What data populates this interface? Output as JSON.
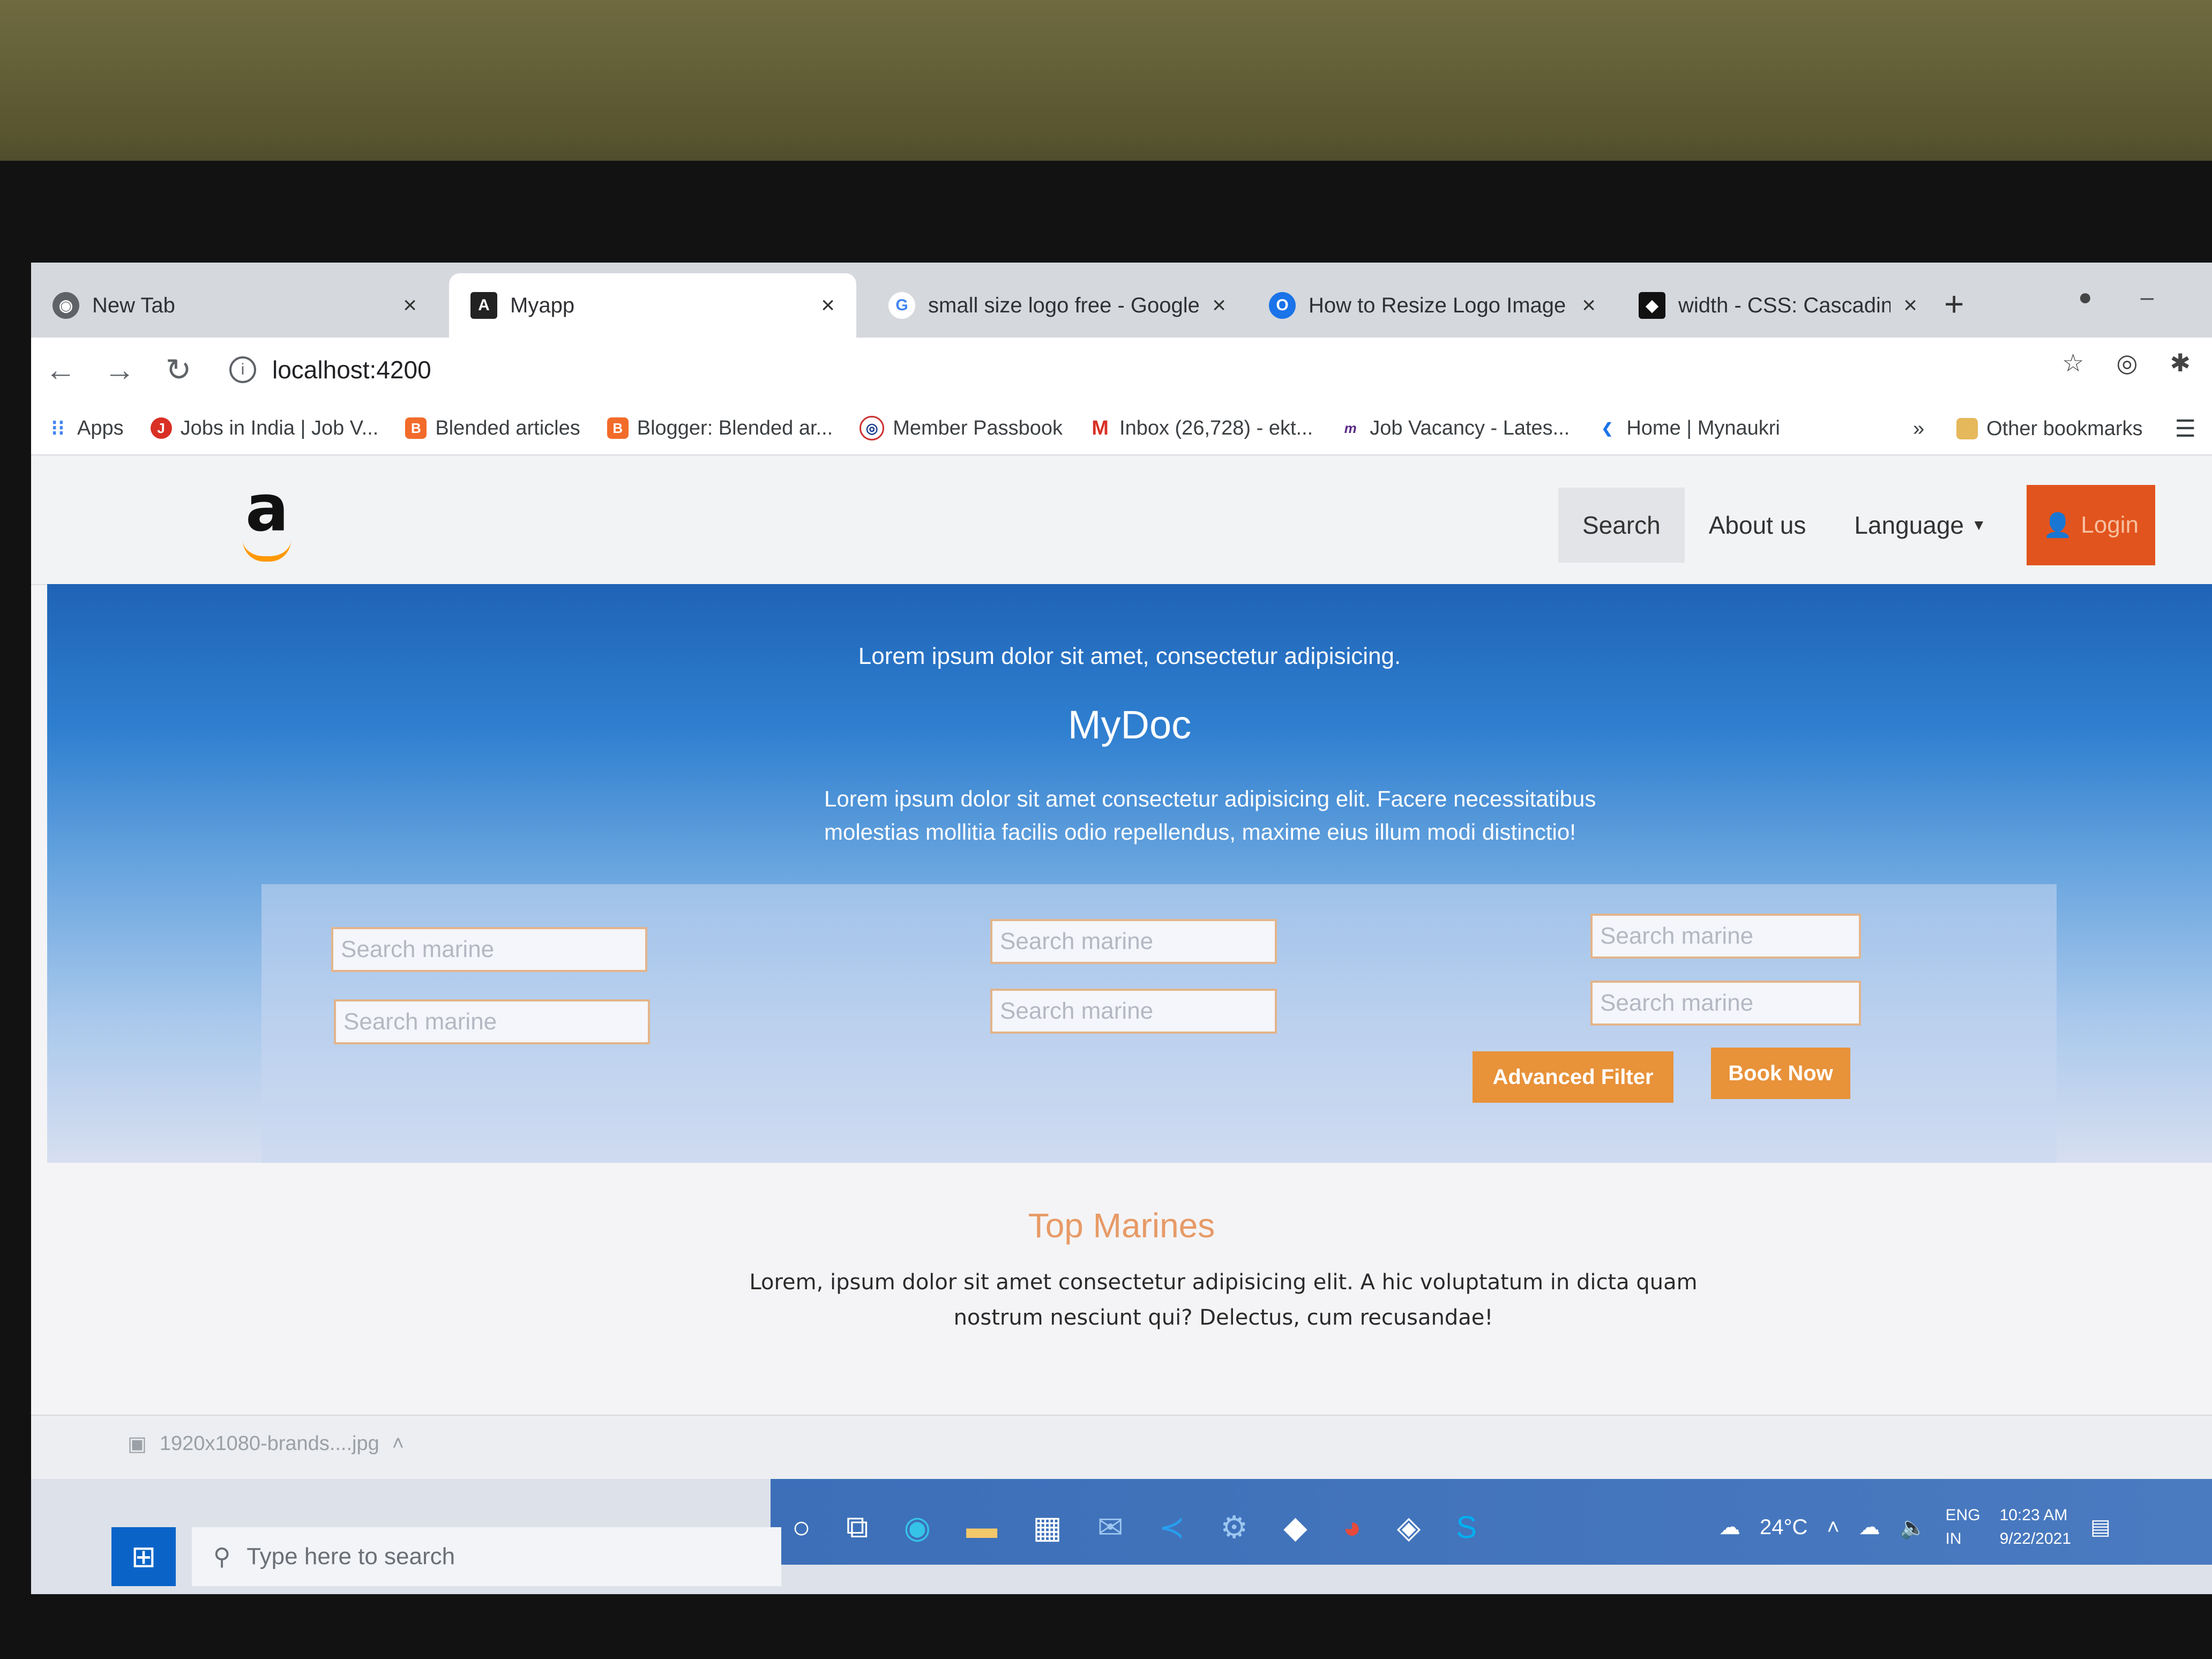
{
  "browser": {
    "tabs": [
      {
        "title": "New Tab",
        "icon": "chrome-icon",
        "active": false
      },
      {
        "title": "Myapp",
        "icon": "angular-icon",
        "active": true
      },
      {
        "title": "small size logo free - Google",
        "icon": "google-icon",
        "active": false
      },
      {
        "title": "How to Resize Logo Image in",
        "icon": "site-icon",
        "active": false
      },
      {
        "title": "width - CSS: Cascading Style",
        "icon": "mdn-icon",
        "active": false
      }
    ],
    "close_glyph": "×",
    "new_tab": "+",
    "url": "localhost:4200",
    "bookmarks": [
      {
        "label": "Apps",
        "icon": "apps-grid-icon"
      },
      {
        "label": "Jobs in India | Job V...",
        "icon": "jobs-icon"
      },
      {
        "label": "Blended articles",
        "icon": "blogger-icon"
      },
      {
        "label": "Blogger: Blended ar...",
        "icon": "blogger-icon"
      },
      {
        "label": "Member Passbook",
        "icon": "epfo-icon"
      },
      {
        "label": "Inbox (26,728) - ekt...",
        "icon": "gmail-icon"
      },
      {
        "label": "Job Vacancy - Lates...",
        "icon": "monster-icon"
      },
      {
        "label": "Home | Mynaukri",
        "icon": "mynaukri-icon"
      }
    ],
    "more_bookmarks": "»",
    "other_bookmarks": "Other bookmarks"
  },
  "site": {
    "logo": "a",
    "nav": {
      "search": "Search",
      "about": "About us",
      "language": "Language",
      "login": "Login"
    },
    "hero": {
      "tagline": "Lorem ipsum dolor sit amet, consectetur adipisicing.",
      "title": "MyDoc",
      "description": "Lorem ipsum dolor sit amet consectetur adipisicing elit. Facere necessitatibus molestias mollitia facilis odio repellendus, maxime eius illum modi distinctio!"
    },
    "search_placeholder": "Search marine",
    "buttons": {
      "advanced_filter": "Advanced Filter",
      "book_now": "Book Now"
    },
    "section": {
      "title": "Top Marines",
      "text": "Lorem, ipsum dolor sit amet consectetur adipisicing elit. A hic voluptatum in dicta quam nostrum nesciunt qui? Delectus, cum recusandae!"
    }
  },
  "downloads": {
    "file": "1920x1080-brands....jpg"
  },
  "taskbar": {
    "search_placeholder": "Type here to search",
    "temperature": "24°C",
    "language": "ENG",
    "region": "IN",
    "time": "10:23 AM",
    "date": "9/22/2021"
  },
  "colors": {
    "accent_orange": "#e8923a",
    "login_red": "#e2541d",
    "hero_blue": "#1f63b6"
  }
}
